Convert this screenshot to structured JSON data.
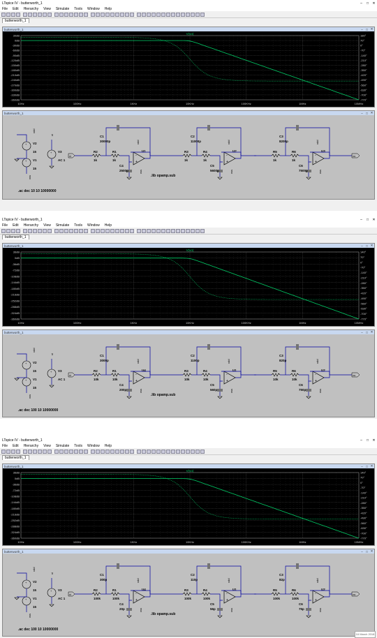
{
  "app": {
    "title": "LTspice IV - butterworth_1",
    "menu": [
      "File",
      "Edit",
      "Hierarchy",
      "View",
      "Simulate",
      "Tools",
      "Window",
      "Help"
    ],
    "tab": "butterworth_1",
    "plot_pane_title": "butterworth_1",
    "sch_pane_title": "butterworth_1"
  },
  "plots": [
    {
      "trace": "V(vo)",
      "left_ticks": [
        "30dB",
        "0dB",
        "-30dB",
        "-60dB",
        "-90dB",
        "-120dB",
        "-150dB",
        "-180dB",
        "-210dB",
        "-240dB",
        "-270dB",
        "-300dB",
        "-330dB",
        "-360dB"
      ],
      "right_ticks": [
        "180°",
        "70°",
        "0°",
        "-70°",
        "-140°",
        "-210°",
        "-280°",
        "-350°",
        "-420°",
        "-490°",
        "-560°",
        "-630°",
        "-700°",
        "-770°"
      ],
      "x_ticks": [
        "10Hz",
        "100Hz",
        "1KHz",
        "10KHz",
        "100KHz",
        "1MHz",
        "10MHz"
      ]
    },
    {
      "trace": "V(vo)",
      "left_ticks": [
        "36dB",
        "0dB",
        "-36dB",
        "-72dB",
        "-108dB",
        "-144dB",
        "-180dB",
        "-216dB",
        "-252dB",
        "-288dB",
        "-324dB",
        "-360dB"
      ],
      "right_ticks": [
        "140°",
        "70°",
        "0°",
        "-70°",
        "-140°",
        "-210°",
        "-280°",
        "-350°",
        "-420°",
        "-490°",
        "-560°",
        "-630°",
        "-700°",
        "-770°"
      ],
      "x_ticks": [
        "10Hz",
        "100Hz",
        "1KHz",
        "10KHz",
        "100KHz",
        "1MHz",
        "10MHz"
      ]
    },
    {
      "trace": "V(vo)",
      "left_ticks": [
        "36dB",
        "0dB",
        "-36dB",
        "-72dB",
        "-108dB",
        "-144dB",
        "-180dB",
        "-216dB",
        "-252dB",
        "-288dB",
        "-324dB",
        "-360dB"
      ],
      "right_ticks": [
        "140°",
        "70°",
        "0°",
        "-70°",
        "-140°",
        "-210°",
        "-280°",
        "-350°",
        "-420°",
        "-490°",
        "-560°",
        "-630°",
        "-700°",
        "-770°"
      ],
      "x_ticks": [
        "10Hz",
        "100Hz",
        "1KHz",
        "10KHz",
        "100KHz",
        "1MHz",
        "10MHz"
      ]
    }
  ],
  "schematics": [
    {
      "c1": "30000p",
      "c2": "11000p",
      "c3": "8200p",
      "c4": "2500p",
      "c5": "5600p",
      "c6": "7500p",
      "r1": "1k",
      "r2": "1k",
      "r3": "1k",
      "r4": "1k",
      "r5": "1k",
      "r6": "1k",
      "u1": "U1",
      "u2": "U2",
      "u3": "U3",
      "directive": ".ac dec 10 10 10000000",
      "lib": ".lib opamp.sub",
      "v1": "V1",
      "v2": "V2",
      "v3": "V3",
      "v1val": "15",
      "v2val": "15",
      "v3val": "AC 1",
      "vi": "vi",
      "vo": "vo",
      "vdd": "vdd",
      "vss": "vss"
    },
    {
      "c1": "3000p",
      "c2": "1100p",
      "c3": "820p",
      "c4": "200p",
      "c5": "560p",
      "c6": "750p",
      "r1": "10k",
      "r2": "10k",
      "r3": "10k",
      "r4": "10k",
      "r5": "10k",
      "r6": "10k",
      "u1": "U4",
      "u2": "U1",
      "u3": "U2",
      "directive": ".ac dec 100 10 10000000",
      "lib": ".lib opamp.sub",
      "v1": "V1",
      "v2": "V2",
      "v3": "V3",
      "v1val": "15",
      "v2val": "15",
      "v3val": "AC 1",
      "vi": "vi",
      "vo": "vo",
      "vdd": "vdd",
      "vss": "vss"
    },
    {
      "c1": "300p",
      "c2": "110p",
      "c3": "82p",
      "c4": "20p",
      "c5": "56p",
      "c6": "75p",
      "r1": "100k",
      "r2": "100k",
      "r3": "100k",
      "r4": "100k",
      "r5": "100k",
      "r6": "100k",
      "u1": "U4",
      "u2": "U1",
      "u3": "U2",
      "directive": ".ac dec 100 10 10000000",
      "lib": ".lib opamp.sub",
      "v1": "V1",
      "v2": "V2",
      "v3": "V3",
      "v1val": "15",
      "v2val": "15",
      "v3val": "AC 1",
      "vi": "vi",
      "vo": "vo",
      "vdd": "vdd",
      "vss": "vss"
    }
  ],
  "footer": "16 March 2018",
  "colors": {
    "trace": "#00cc66",
    "grid": "#555555",
    "wire": "#0000a0",
    "bg_plot": "#000000",
    "bg_sch": "#c0c0c0"
  }
}
